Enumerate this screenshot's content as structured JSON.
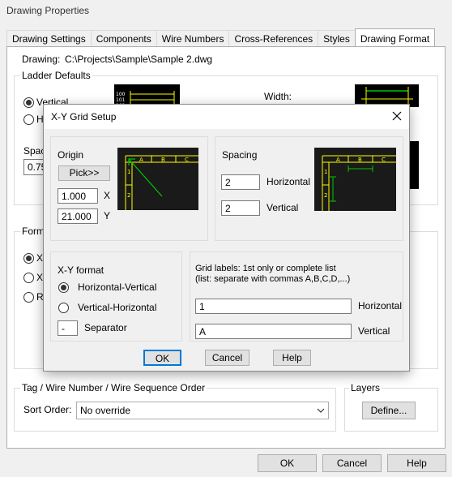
{
  "window": {
    "title": "Drawing Properties"
  },
  "tabs": [
    "Drawing Settings",
    "Components",
    "Wire Numbers",
    "Cross-References",
    "Styles",
    "Drawing Format"
  ],
  "drawing": {
    "label": "Drawing:",
    "path": "C:\\Projects\\Sample\\Sample 2.dwg"
  },
  "ladder": {
    "group_label": "Ladder Defaults",
    "radio_vertical": "Vertical",
    "radio_horizontal": "Ho",
    "spacing_label": "Spac",
    "spacing_value": "0.75",
    "width_label": "Width:",
    "thumb_numbers": [
      "100",
      "101",
      "102"
    ]
  },
  "format": {
    "group_label": "Forma",
    "radio1": "X-",
    "radio2": "X",
    "radio3": "R"
  },
  "tag_order": {
    "group_label": "Tag / Wire Number / Wire Sequence Order",
    "sort_label": "Sort Order:",
    "sort_value": "No override"
  },
  "layers": {
    "group_label": "Layers",
    "define_button": "Define..."
  },
  "bottom_buttons": {
    "ok": "OK",
    "cancel": "Cancel",
    "help": "Help"
  },
  "dialog": {
    "title": "X-Y Grid Setup",
    "origin": {
      "label": "Origin",
      "pick_button": "Pick>>",
      "x_value": "1.000",
      "x_label": "X",
      "y_value": "21.000",
      "y_label": "Y"
    },
    "spacing": {
      "label": "Spacing",
      "horizontal_value": "2",
      "horizontal_label": "Horizontal",
      "vertical_value": "2",
      "vertical_label": "Vertical"
    },
    "grid_letters": [
      "A",
      "B",
      "C"
    ],
    "grid_numbers": [
      "1",
      "2"
    ],
    "xy_format": {
      "label": "X-Y format",
      "option1": "Horizontal-Vertical",
      "option2": "Vertical-Horizontal",
      "selected": "Horizontal-Vertical",
      "separator_value": "-",
      "separator_label": "Separator"
    },
    "grid_labels": {
      "line1": "Grid labels: 1st only or complete list",
      "line2": "(list: separate with commas A,B,C,D,...)",
      "horizontal_value": "1",
      "horizontal_label": "Horizontal",
      "vertical_value": "A",
      "vertical_label": "Vertical"
    },
    "buttons": {
      "ok": "OK",
      "cancel": "Cancel",
      "help": "Help"
    }
  },
  "colors": {
    "accent": "#0078d7",
    "thumb_line": "#ffff00",
    "thumb_green": "#00c800",
    "thumb_bg": "#000000"
  }
}
